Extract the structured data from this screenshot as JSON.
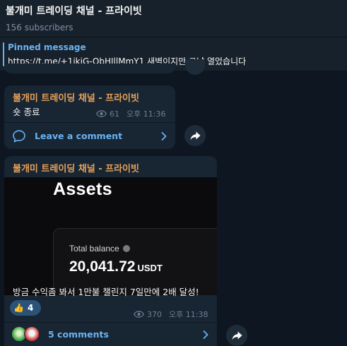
{
  "channel": {
    "title": "불개미 트레이딩 채널 - 프라이빗",
    "subscribers": "156 subscribers"
  },
  "pinned": {
    "label": "Pinned message",
    "text": "https://t.me/+1jkjG-ObHJllMmY1  새벽이지만 그냥 열었습니다"
  },
  "messages": [
    {
      "sender": "불개미 트레이딩 채널 - 프라이빗",
      "text": "숏 종료",
      "views": "61",
      "time": "오후 11:36",
      "comments_label": "Leave a comment"
    },
    {
      "sender": "불개미 트레이딩 채널 - 프라이빗",
      "media": {
        "heading": "Assets",
        "balance_label": "Total balance",
        "balance_value": "20,041.72",
        "balance_unit": "USDT"
      },
      "text": "방금 수익좀 봐서 1만불 챌린지 7일만에 2배 달성!",
      "reaction_emoji": "👍",
      "reaction_count": "4",
      "views": "370",
      "time": "오후 11:38",
      "comments_label": "5 comments"
    }
  ],
  "colors": {
    "background": "#0e1621",
    "bubble": "#182533",
    "sender": "#e8a15a",
    "link": "#6ab3f3",
    "meta": "#6d7f8f"
  }
}
